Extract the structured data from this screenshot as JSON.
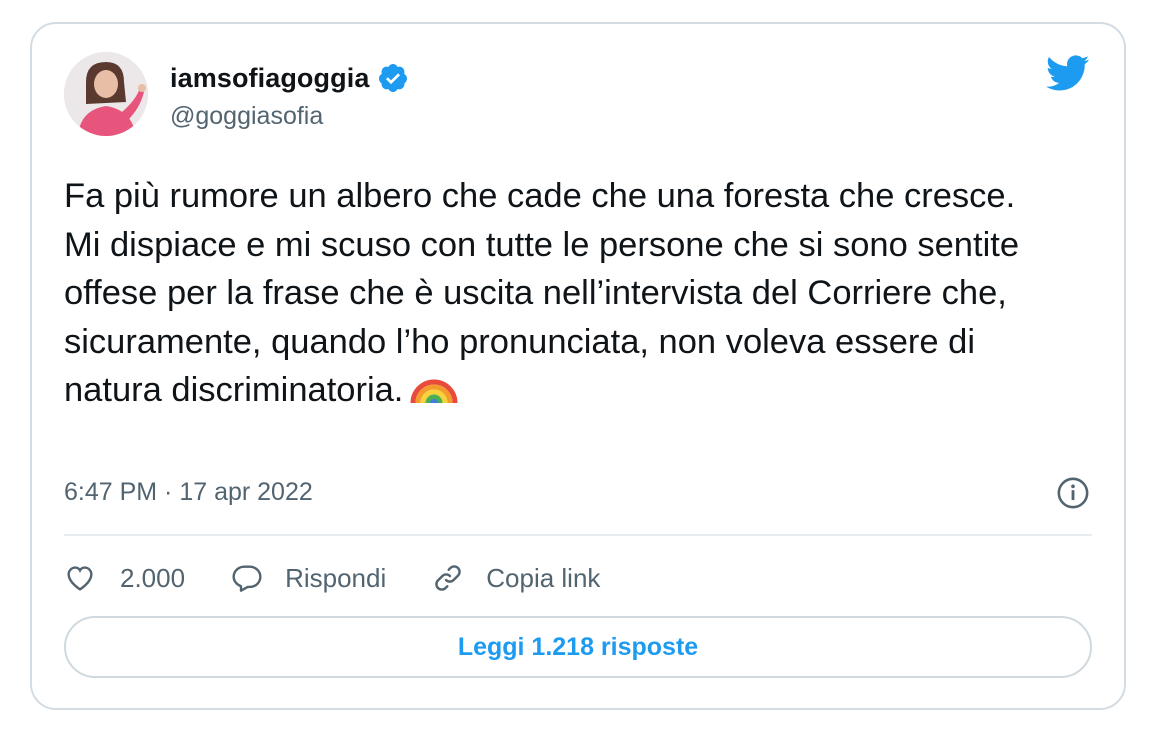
{
  "author": {
    "display_name": "iamsofiagoggia",
    "handle": "@goggiasofia",
    "verified": true
  },
  "tweet": {
    "text": "Fa più rumore un albero che cade che una foresta che cresce.\nMi dispiace e mi scuso con tutte le persone che si sono sentite offese per la frase che è uscita nell’intervista del Corriere che, sicuramente, quando l’ho pronunciata, non voleva essere di natura discriminatoria.",
    "emoji": "rainbow-emoji",
    "timestamp": "6:47 PM · 17 apr 2022"
  },
  "actions": {
    "likes": "2.000",
    "reply_label": "Rispondi",
    "copy_link_label": "Copia link"
  },
  "read_replies_label": "Leggi 1.218 risposte",
  "icons": [
    "verified-badge-icon",
    "twitter-bird-icon",
    "info-icon",
    "heart-icon",
    "reply-bubble-icon",
    "link-icon"
  ],
  "colors": {
    "brand_blue": "#1d9bf0",
    "text_primary": "#0f1419",
    "text_secondary": "#536471",
    "border": "#d3dce3"
  }
}
